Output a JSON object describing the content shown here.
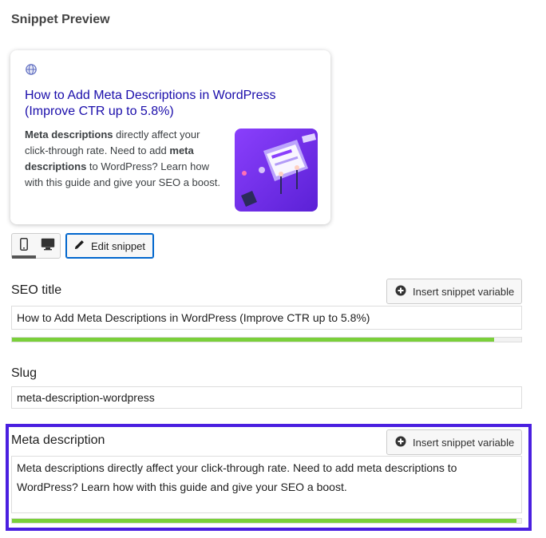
{
  "header": {
    "title": "Snippet Preview"
  },
  "preview": {
    "title": "How to Add Meta Descriptions in WordPress (Improve CTR up to 5.8%)",
    "description_bold_1": "Meta descriptions",
    "description_text_1": " directly affect your click-through rate. Need to add ",
    "description_bold_2": "meta descriptions",
    "description_text_2": " to WordPress? Learn how with this guide and give your SEO a boost.",
    "globe_icon": "globe-icon",
    "thumbnail_colors": {
      "bg_start": "#7b2ff7",
      "bg_end": "#5b21d6"
    }
  },
  "toolbar": {
    "mobile_icon": "mobile-icon",
    "desktop_icon": "desktop-icon",
    "edit_label": "Edit snippet"
  },
  "seo_title": {
    "label": "SEO title",
    "insert_label": "Insert snippet variable",
    "value": "How to Add Meta Descriptions in WordPress (Improve CTR up to 5.8%)",
    "progress": 0.946
  },
  "slug": {
    "label": "Slug",
    "value": "meta-description-wordpress"
  },
  "meta_description": {
    "label": "Meta description",
    "insert_label": "Insert snippet variable",
    "value": "Meta descriptions directly affect your click-through rate. Need to add meta descriptions to WordPress? Learn how with this guide and give your SEO a boost.",
    "progress": 0.99
  },
  "colors": {
    "link": "#1a0dab",
    "accent": "#0066cd",
    "progress_good": "#7ad03a",
    "highlight": "#4a1fe0"
  }
}
